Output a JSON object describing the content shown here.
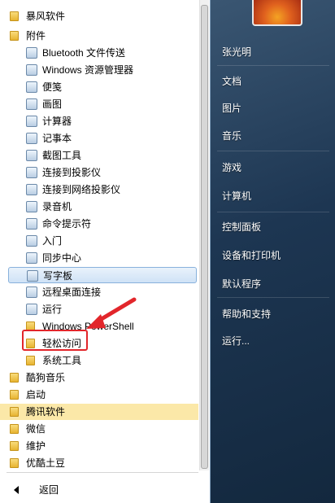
{
  "programs": [
    {
      "label": "暴风软件",
      "icon": "folder-icon",
      "level": 0
    },
    {
      "label": "附件",
      "icon": "folder-icon",
      "level": 0
    },
    {
      "label": "Bluetooth 文件传送",
      "icon": "bluetooth-icon",
      "level": 1
    },
    {
      "label": "Windows 资源管理器",
      "icon": "explorer-icon",
      "level": 1
    },
    {
      "label": "便笺",
      "icon": "sticky-notes-icon",
      "level": 1
    },
    {
      "label": "画图",
      "icon": "paint-icon",
      "level": 1
    },
    {
      "label": "计算器",
      "icon": "calculator-icon",
      "level": 1
    },
    {
      "label": "记事本",
      "icon": "notepad-icon",
      "level": 1
    },
    {
      "label": "截图工具",
      "icon": "snipping-tool-icon",
      "level": 1
    },
    {
      "label": "连接到投影仪",
      "icon": "projector-icon",
      "level": 1
    },
    {
      "label": "连接到网络投影仪",
      "icon": "network-projector-icon",
      "level": 1
    },
    {
      "label": "录音机",
      "icon": "microphone-icon",
      "level": 1
    },
    {
      "label": "命令提示符",
      "icon": "command-prompt-icon",
      "level": 1
    },
    {
      "label": "入门",
      "icon": "getting-started-icon",
      "level": 1
    },
    {
      "label": "同步中心",
      "icon": "sync-center-icon",
      "level": 1
    },
    {
      "label": "写字板",
      "icon": "wordpad-icon",
      "level": 1
    },
    {
      "label": "远程桌面连接",
      "icon": "remote-desktop-icon",
      "level": 1
    },
    {
      "label": "运行",
      "icon": "run-icon",
      "level": 1
    },
    {
      "label": "Windows PowerShell",
      "icon": "folder-icon",
      "level": 1
    },
    {
      "label": "轻松访问",
      "icon": "folder-icon",
      "level": 1
    },
    {
      "label": "系统工具",
      "icon": "folder-icon",
      "level": 1
    },
    {
      "label": "酷狗音乐",
      "icon": "folder-icon",
      "level": 0
    },
    {
      "label": "启动",
      "icon": "folder-icon",
      "level": 0
    },
    {
      "label": "腾讯软件",
      "icon": "folder-icon",
      "level": 0
    },
    {
      "label": "微信",
      "icon": "folder-icon",
      "level": 0
    },
    {
      "label": "维护",
      "icon": "folder-icon",
      "level": 0
    },
    {
      "label": "优酷土豆",
      "icon": "folder-icon",
      "level": 0
    }
  ],
  "back_label": "返回",
  "right_links": [
    "张光明",
    "文档",
    "图片",
    "音乐",
    "游戏",
    "计算机",
    "控制面板",
    "设备和打印机",
    "默认程序",
    "帮助和支持",
    "运行..."
  ],
  "colors": {
    "selection_hover": "#cfe2f6",
    "selection_tencent": "#fbe8a8",
    "annotation_red": "#e2262b",
    "right_panel": "#1d3652"
  }
}
